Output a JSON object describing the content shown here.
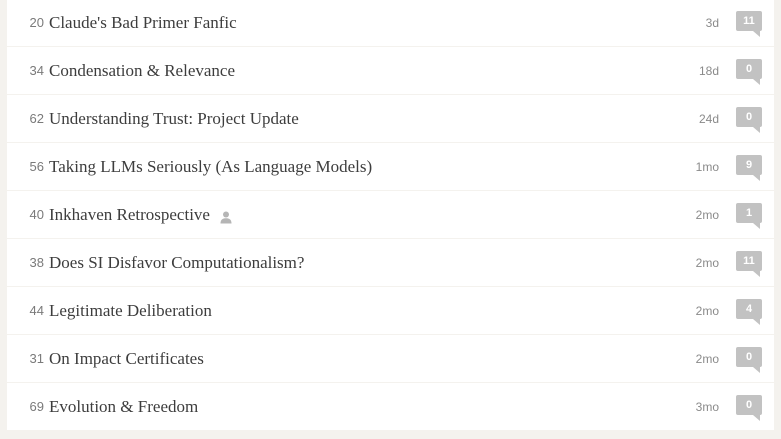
{
  "posts": [
    {
      "karma": "20",
      "title": "Claude's Bad Primer Fanfic",
      "date": "3d",
      "comments": "11",
      "author_icon": false
    },
    {
      "karma": "34",
      "title": "Condensation & Relevance",
      "date": "18d",
      "comments": "0",
      "author_icon": false
    },
    {
      "karma": "62",
      "title": "Understanding Trust: Project Update",
      "date": "24d",
      "comments": "0",
      "author_icon": false
    },
    {
      "karma": "56",
      "title": "Taking LLMs Seriously (As Language Models)",
      "date": "1mo",
      "comments": "9",
      "author_icon": false
    },
    {
      "karma": "40",
      "title": "Inkhaven Retrospective",
      "date": "2mo",
      "comments": "1",
      "author_icon": true
    },
    {
      "karma": "38",
      "title": "Does SI Disfavor Computationalism?",
      "date": "2mo",
      "comments": "11",
      "author_icon": false
    },
    {
      "karma": "44",
      "title": "Legitimate Deliberation",
      "date": "2mo",
      "comments": "4",
      "author_icon": false
    },
    {
      "karma": "31",
      "title": "On Impact Certificates",
      "date": "2mo",
      "comments": "0",
      "author_icon": false
    },
    {
      "karma": "69",
      "title": "Evolution & Freedom",
      "date": "3mo",
      "comments": "0",
      "author_icon": false
    }
  ],
  "colors": {
    "background": "#f4f2ee",
    "row_background": "#ffffff",
    "comment_bubble": "#c2c2c2",
    "title_text": "#3d3d3d",
    "meta_text": "#8a8a8a"
  },
  "icons": {
    "author": "person-icon",
    "comments": "comment-bubble-icon"
  }
}
